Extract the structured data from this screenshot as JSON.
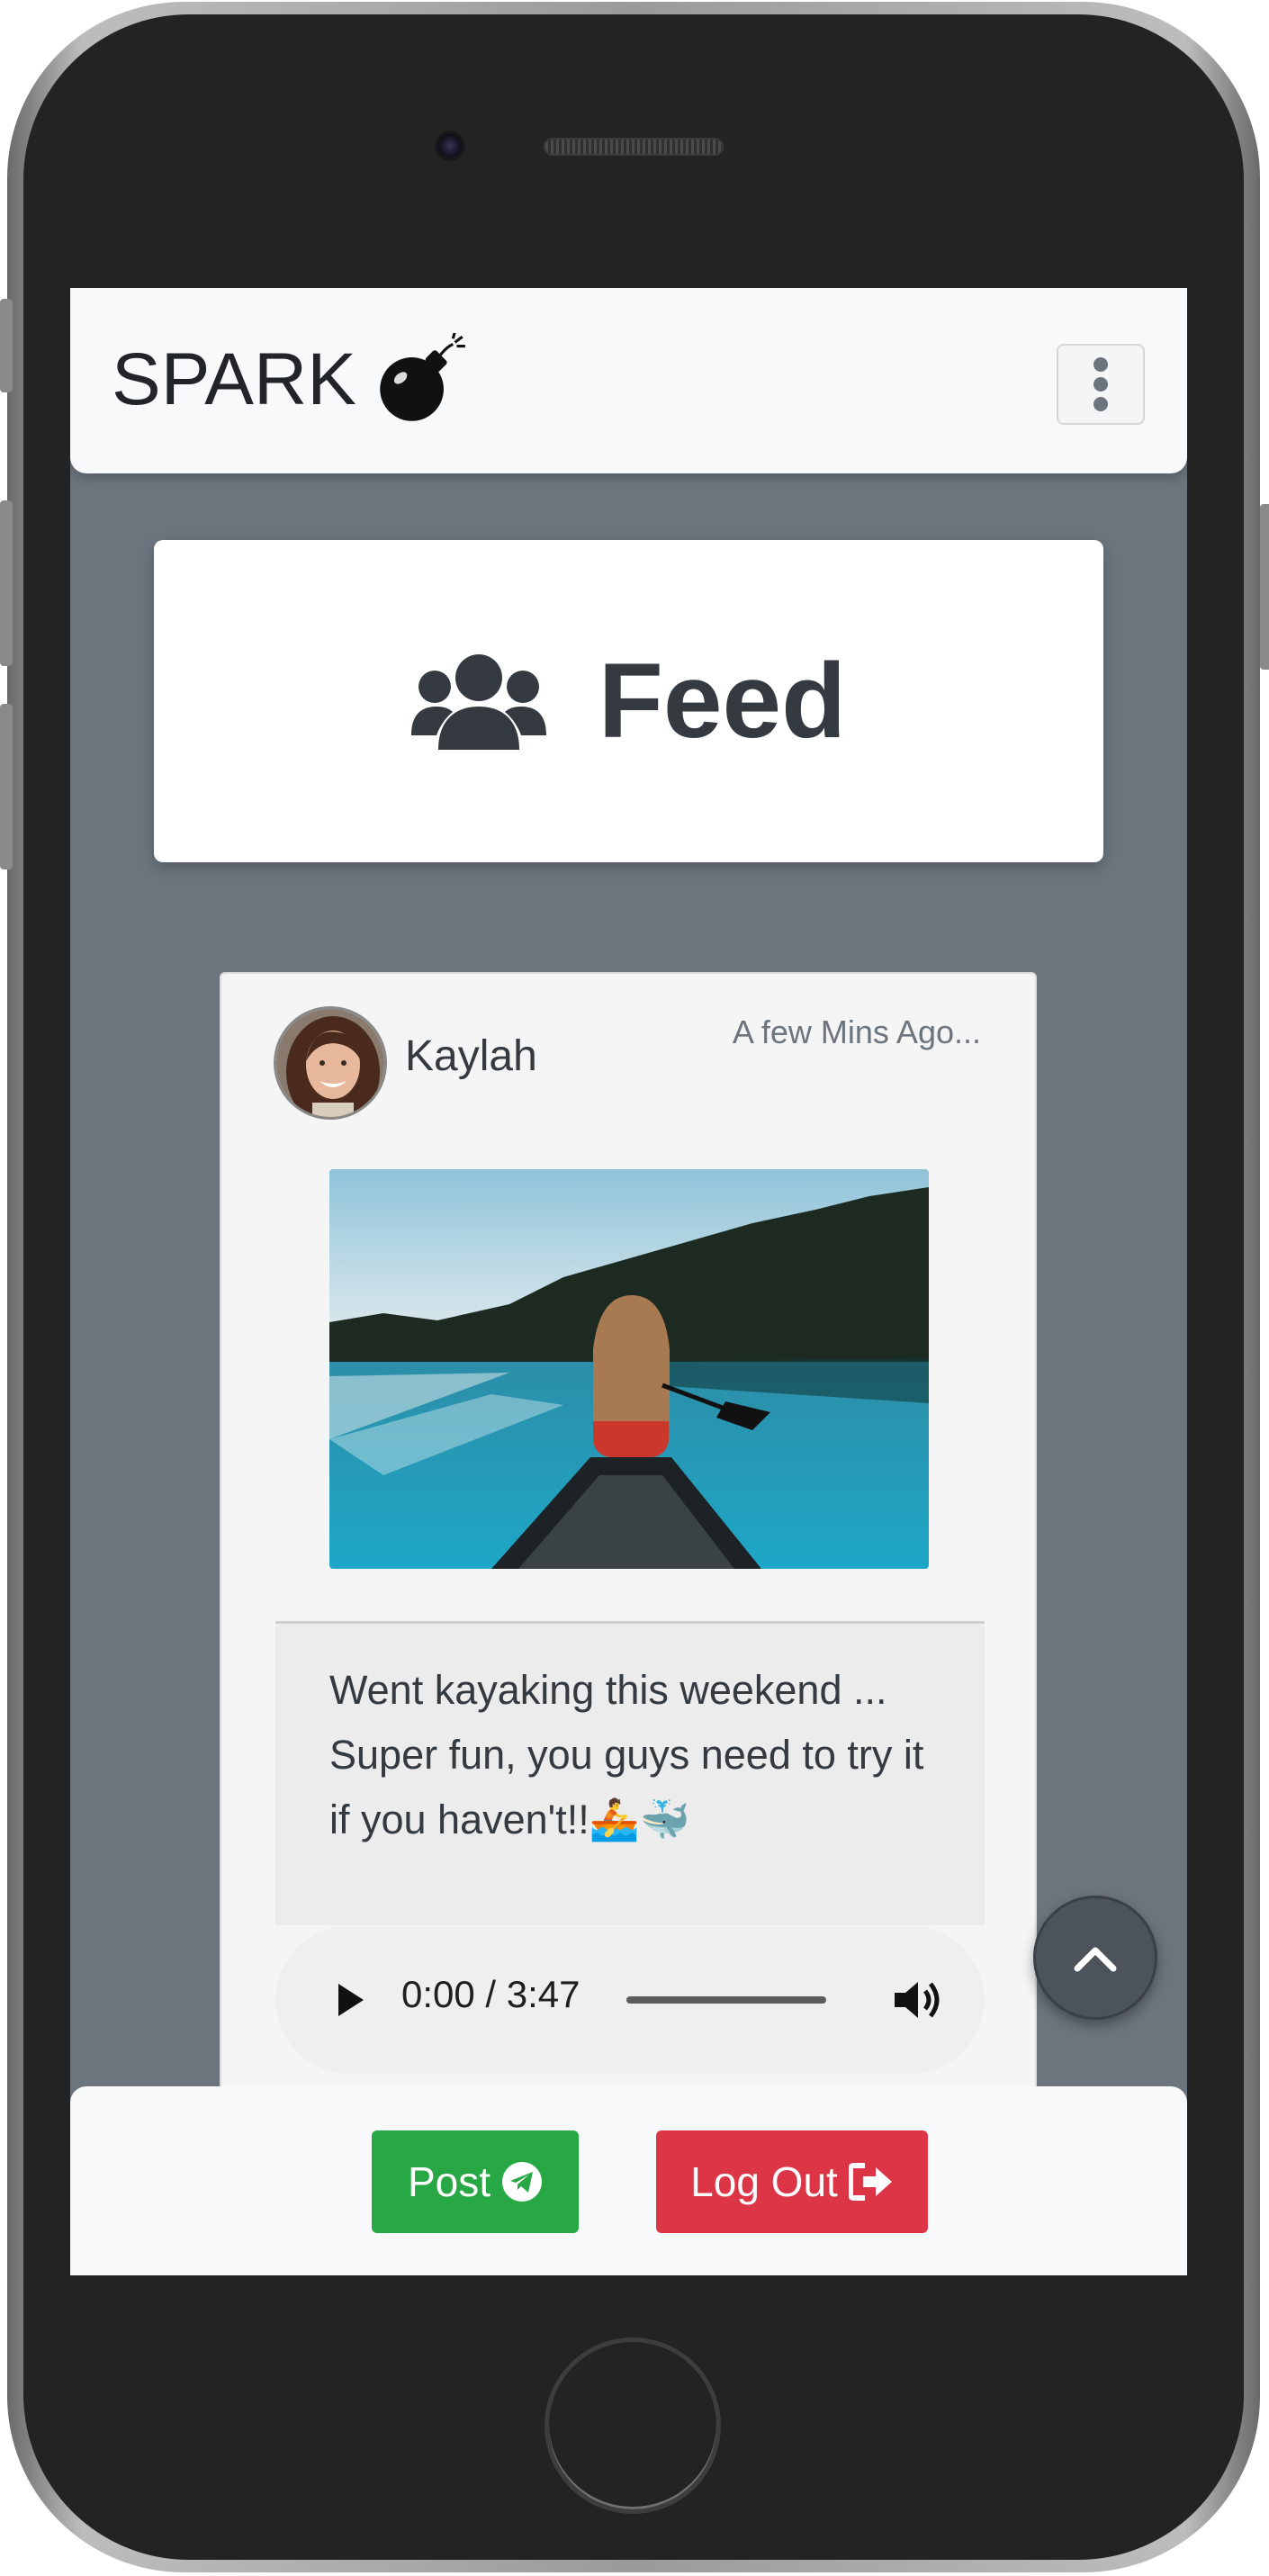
{
  "app": {
    "brand": "SPARK",
    "brand_icon": "bomb-icon",
    "menu_icon": "vertical-dots-icon"
  },
  "feed_header": {
    "icon": "users-icon",
    "title": "Feed"
  },
  "post": {
    "username": "Kaylah",
    "timestamp": "A few Mins Ago...",
    "photo_description_icon": "kayak-photo",
    "text": "Went kayaking this weekend ... Super fun, you guys need to try it if you haven't!!🚣🐳",
    "audio": {
      "time": "0:00 / 3:47",
      "progress": 0
    }
  },
  "scroll_top_icon": "chevron-up-icon",
  "bottom_bar": {
    "post_label": "Post",
    "post_icon": "telegram-plane-icon",
    "logout_label": "Log Out",
    "logout_icon": "sign-out-icon"
  },
  "colors": {
    "navbar_bg": "#f8f9fa",
    "screen_bg": "#6c757d",
    "post_btn": "#28a745",
    "logout_btn": "#dc3545",
    "text_dark": "#343a40"
  }
}
